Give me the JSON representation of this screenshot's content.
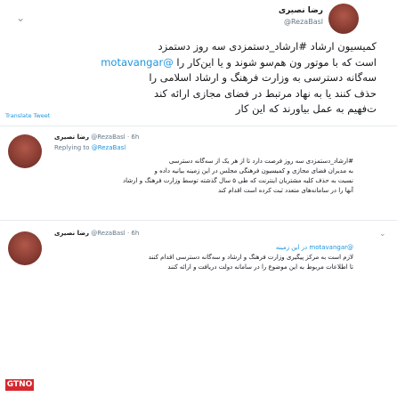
{
  "main_tweet": {
    "author_name": "رضا نصیری",
    "author_handle": "@RezaBasl",
    "chevron": "⌄",
    "body_lines": [
      "کمیسیون ارشاد #ارشاد_دستمزدی سه روز دستمزد",
      "است که با موتور ون هم‌سو شوند و یا این‌کار را",
      "سه‌گانه دسترسی به وزارت فرهنگ و ارشاد اسلامی را",
      "حذف کنند یا به نهاد مرتبط در فضای مجازی ارائه کند",
      "ت‌فهیم به عمل بیاورند که این کار"
    ],
    "mention": "@motavangar",
    "translate_label": "Translate Tweet"
  },
  "replies": [
    {
      "author_name": "رضا نصیری",
      "handle_time": "@RezaBasl · 6h",
      "replying_prefix": "Replying to",
      "replying_handle": "@RezaBasl",
      "body_lines": [
        "#ارشاد_دستمزدی سه روز فرصت دارد تا از هر یک از سه‌گانه دسترسی",
        "به مدیران فضای مجازی و کمیسیون فرهنگی مجلس در این زمینه بیانیه داده و",
        "نسبت به حذف کلیه مشتریان اینترنت که طی ۵ سال گذشته توسط وزارت فرهنگ و ارشاد",
        "آنها را در سامانه‌های متعدد ثبت کرده است اقدام کند"
      ],
      "chevron": "⌄"
    },
    {
      "author_name": "رضا نصیری",
      "handle_time": "@RezaBasl · 6h",
      "mention_line": "@motavangar در این زمینه",
      "body_lines": [
        "لازم است به مرکز پیگیری وزارت فرهنگ و ارشاد و سه‌گانه دسترسی اقدام کنند",
        "تا اطلاعات مربوط به این موضوع را در سامانه دولت دریافت و ارائه کنند"
      ],
      "chevron": "⌄"
    }
  ],
  "logo_text": "GTNO"
}
